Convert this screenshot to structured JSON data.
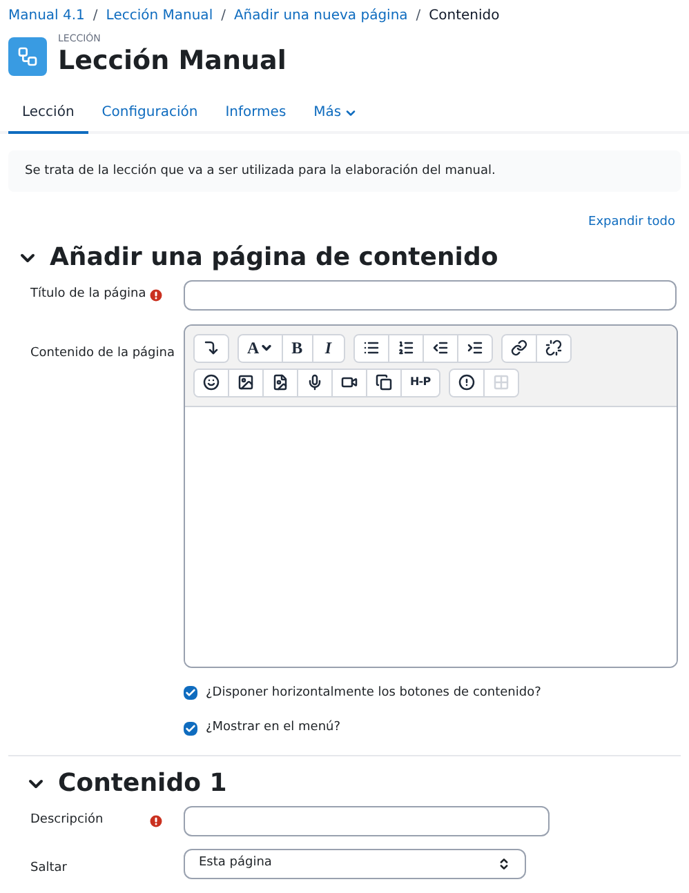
{
  "breadcrumb_separator": "/",
  "breadcrumb": [
    {
      "label": "Manual 4.1",
      "link": true
    },
    {
      "label": "Lección Manual",
      "link": true
    },
    {
      "label": "Añadir una nueva página",
      "link": true
    },
    {
      "label": "Contenido",
      "link": false
    }
  ],
  "header": {
    "kicker": "LECCIÓN",
    "title": "Lección Manual"
  },
  "tabs": [
    {
      "label": "Lección",
      "selected": true,
      "dropdown": false
    },
    {
      "label": "Configuración",
      "selected": false,
      "dropdown": false
    },
    {
      "label": "Informes",
      "selected": false,
      "dropdown": false
    },
    {
      "label": "Más",
      "selected": false,
      "dropdown": true
    }
  ],
  "info": "Se trata de la lección que va a ser utilizada para la elaboración del manual.",
  "expand_all": "Expandir todo",
  "section1": {
    "title": "Añadir una página de contenido",
    "expanded": true,
    "title_field": {
      "label": "Título de la página",
      "required": true
    },
    "content_field": {
      "label": "Contenido de la página"
    },
    "toolbar": [
      [
        [
          {
            "kind": "collapse"
          }
        ],
        [
          {
            "kind": "font",
            "label": "A"
          },
          {
            "kind": "bold",
            "label": "B"
          },
          {
            "kind": "italic",
            "label": "I"
          }
        ],
        [
          {
            "kind": "bullets"
          },
          {
            "kind": "numbers"
          },
          {
            "kind": "outdent"
          },
          {
            "kind": "indent"
          }
        ],
        [
          {
            "kind": "link"
          },
          {
            "kind": "unlink"
          }
        ]
      ],
      [
        [
          {
            "kind": "emoji"
          },
          {
            "kind": "image"
          },
          {
            "kind": "media"
          },
          {
            "kind": "mic"
          },
          {
            "kind": "video"
          },
          {
            "kind": "copy"
          },
          {
            "kind": "h5p",
            "label": "H-P"
          }
        ],
        [
          {
            "kind": "accessibility"
          },
          {
            "kind": "grid",
            "disabled": true
          }
        ]
      ]
    ],
    "checkboxes": [
      {
        "label": "¿Disponer horizontalmente los botones de contenido?",
        "checked": true
      },
      {
        "label": "¿Mostrar en el menú?",
        "checked": true
      }
    ]
  },
  "section2": {
    "title": "Contenido 1",
    "expanded": true,
    "description": {
      "label": "Descripción",
      "required": true
    },
    "jump": {
      "label": "Saltar",
      "value": "Esta página"
    }
  }
}
